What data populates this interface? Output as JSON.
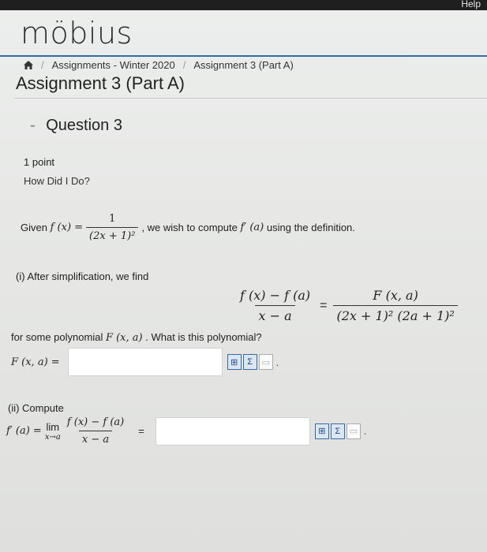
{
  "header": {
    "help_label": "Help",
    "logo_text": "möbius"
  },
  "breadcrumb": {
    "home_icon": "home-icon",
    "items": [
      "Assignments - Winter 2020",
      "Assignment 3 (Part A)"
    ]
  },
  "page": {
    "title": "Assignment 3 (Part A)"
  },
  "question": {
    "dash": "-",
    "title": "Question 3",
    "points": "1 point",
    "how_did_i_do": "How Did I Do?",
    "given_prefix": "Given",
    "given_lhs": "f (x) =",
    "given_num": "1",
    "given_den": "(2x + 1)²",
    "given_suffix": ", we wish to compute",
    "fprime": "f′ (a)",
    "given_end": "using the definition.",
    "part1_label": "(i) After simplification, we find",
    "big_num": "f (x) − f (a)",
    "big_den": "x − a",
    "eq": "=",
    "rhs_num": "F (x, a)",
    "rhs_den": "(2x + 1)² (2a + 1)²",
    "forsome_prefix": "for some polynomial",
    "forsome_F": "F (x, a)",
    "forsome_suffix": ". What is this polynomial?",
    "F_label": "F (x, a) =",
    "F_value": "",
    "part2_label": "(ii) Compute",
    "lim_lhs": "f′ (a) =",
    "lim_word": "lim",
    "lim_sub": "x→a",
    "lim_num": "f (x) − f (a)",
    "lim_den": "x − a",
    "lim_eq": "=",
    "lim_value": ""
  },
  "tools": [
    "equation-editor-icon",
    "formula-icon",
    "preview-icon"
  ]
}
